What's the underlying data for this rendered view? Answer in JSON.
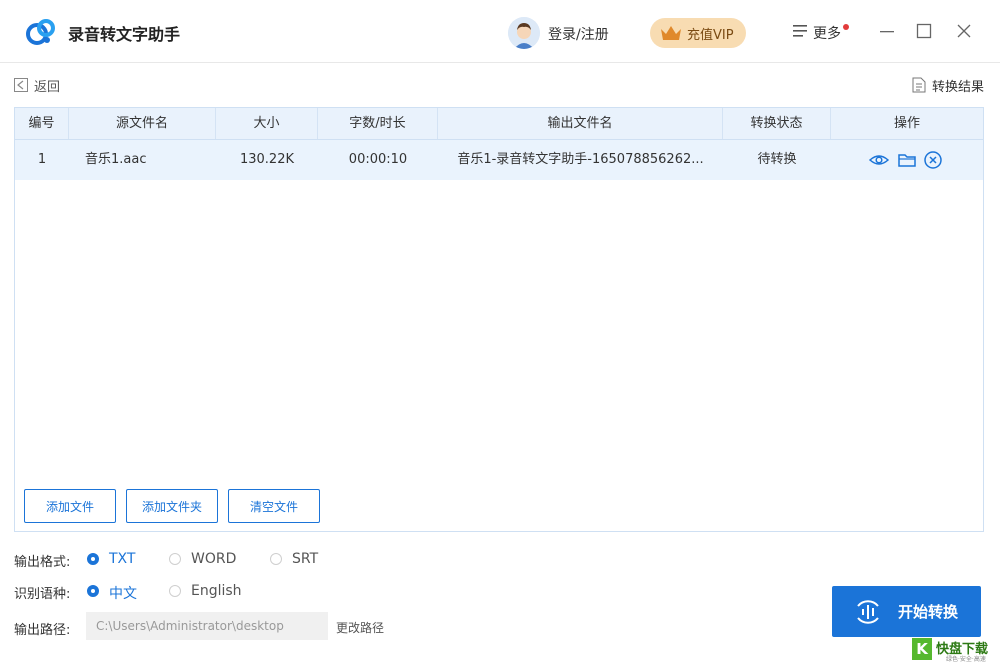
{
  "app": {
    "title": "录音转文字助手"
  },
  "header": {
    "login_label": "登录/注册",
    "vip_label": "充值VIP",
    "more_label": "更多"
  },
  "toolbar": {
    "back_label": "返回",
    "result_label": "转换结果"
  },
  "table": {
    "columns": [
      "编号",
      "源文件名",
      "大小",
      "字数/时长",
      "输出文件名",
      "转换状态",
      "操作"
    ],
    "rows": [
      {
        "index": "1",
        "source": "音乐1.aac",
        "size": "130.22K",
        "duration": "00:00:10",
        "output": "音乐1-录音转文字助手-165078856262...",
        "status": "待转换"
      }
    ]
  },
  "buttons": {
    "add_file": "添加文件",
    "add_folder": "添加文件夹",
    "clear_files": "清空文件",
    "start": "开始转换"
  },
  "output_format": {
    "label": "输出格式:",
    "options": [
      "TXT",
      "WORD",
      "SRT"
    ],
    "selected": "TXT"
  },
  "language": {
    "label": "识别语种:",
    "options": [
      "中文",
      "English"
    ],
    "selected": "中文"
  },
  "output_path": {
    "label": "输出路径:",
    "value": "C:\\Users\\Administrator\\desktop",
    "change_label": "更改路径"
  },
  "watermark": {
    "k": "K",
    "text": "快盘下载",
    "sub": "绿色·安全·高速"
  },
  "colors": {
    "accent": "#1b74d8",
    "header_bg": "#e9f2fc",
    "row_bg": "#eaf3fd",
    "vip_bg": "#f8dcb2",
    "notify_dot": "#e23b3b"
  }
}
